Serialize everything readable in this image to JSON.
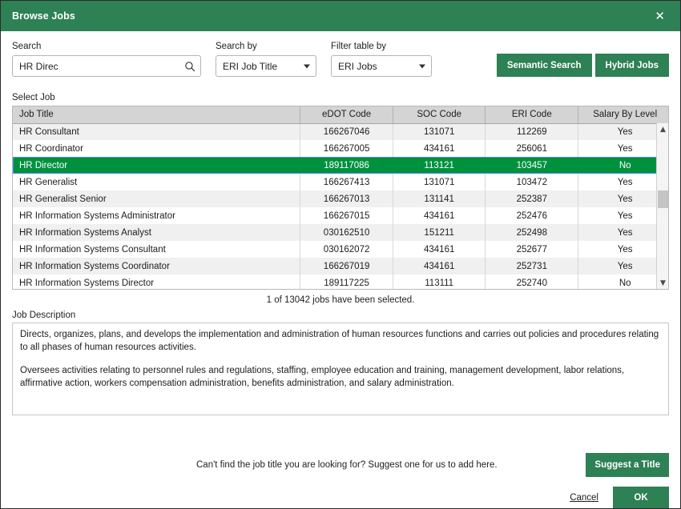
{
  "window": {
    "title": "Browse Jobs",
    "close_icon": "close-icon",
    "header_color": "#2e8055",
    "accent_color": "#00913f"
  },
  "search": {
    "label": "Search",
    "value": "HR Direc",
    "placeholder": "",
    "icon": "search-icon"
  },
  "search_by": {
    "label": "Search by",
    "value": "ERI Job Title",
    "options": [
      "ERI Job Title"
    ]
  },
  "filter_table_by": {
    "label": "Filter table by",
    "value": "ERI Jobs",
    "options": [
      "ERI Jobs"
    ]
  },
  "actions": {
    "semantic_search": "Semantic Search",
    "hybrid_jobs": "Hybrid Jobs"
  },
  "table": {
    "section_label": "Select Job",
    "columns": [
      "Job Title",
      "eDOT Code",
      "SOC Code",
      "ERI Code",
      "Salary By Level"
    ],
    "rows": [
      {
        "job_title": "HR Consultant",
        "edot_code": "166267046",
        "soc_code": "131071",
        "eri_code": "112269",
        "salary_by_level": "Yes",
        "selected": false
      },
      {
        "job_title": "HR Coordinator",
        "edot_code": "166267005",
        "soc_code": "434161",
        "eri_code": "256061",
        "salary_by_level": "Yes",
        "selected": false
      },
      {
        "job_title": "HR Director",
        "edot_code": "189117086",
        "soc_code": "113121",
        "eri_code": "103457",
        "salary_by_level": "No",
        "selected": true
      },
      {
        "job_title": "HR Generalist",
        "edot_code": "166267413",
        "soc_code": "131071",
        "eri_code": "103472",
        "salary_by_level": "Yes",
        "selected": false
      },
      {
        "job_title": "HR Generalist Senior",
        "edot_code": "166267013",
        "soc_code": "131141",
        "eri_code": "252387",
        "salary_by_level": "Yes",
        "selected": false
      },
      {
        "job_title": "HR Information Systems Administrator",
        "edot_code": "166267015",
        "soc_code": "434161",
        "eri_code": "252476",
        "salary_by_level": "Yes",
        "selected": false
      },
      {
        "job_title": "HR Information Systems Analyst",
        "edot_code": "030162510",
        "soc_code": "151211",
        "eri_code": "252498",
        "salary_by_level": "Yes",
        "selected": false
      },
      {
        "job_title": "HR Information Systems Consultant",
        "edot_code": "030162072",
        "soc_code": "434161",
        "eri_code": "252677",
        "salary_by_level": "Yes",
        "selected": false
      },
      {
        "job_title": "HR Information Systems Coordinator",
        "edot_code": "166267019",
        "soc_code": "434161",
        "eri_code": "252731",
        "salary_by_level": "Yes",
        "selected": false
      },
      {
        "job_title": "HR Information Systems Director",
        "edot_code": "189117225",
        "soc_code": "113111",
        "eri_code": "252740",
        "salary_by_level": "No",
        "selected": false
      }
    ],
    "scroll_up_icon": "chevron-up-icon",
    "scroll_down_icon": "chevron-down-icon"
  },
  "selection_count": "1 of 13042 jobs have been selected.",
  "description": {
    "label": "Job Description",
    "paragraphs": [
      "Directs, organizes, plans, and develops the implementation and administration of human resources functions and carries out policies and procedures relating to all phases of human resources activities.",
      "Oversees activities relating to personnel rules and regulations, staffing, employee education and training, management development, labor relations, affirmative action, workers compensation administration, benefits administration, and salary administration."
    ]
  },
  "footer": {
    "suggest_text": "Can't find the job title you are looking for? Suggest one for us to add here.",
    "suggest_button": "Suggest a Title",
    "cancel": "Cancel",
    "ok": "OK"
  }
}
